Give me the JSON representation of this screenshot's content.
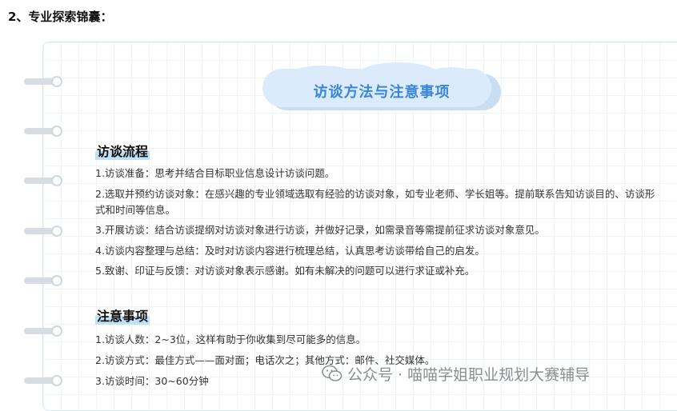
{
  "heading": "2、专业探索锦囊：",
  "card_title": "访谈方法与注意事项",
  "section1": {
    "title": "访谈流程",
    "items": [
      "1.访谈准备：思考并结合目标职业信息设计访谈问题。",
      "2.选取并预约访谈对象：在感兴趣的专业领域选取有经验的访谈对象，如专业老师、学长姐等。提前联系告知访谈目的、访谈形",
      "式和时间等信息。",
      "3.开展访谈：结合访谈提纲对访谈对象进行访谈，并做好记录，如需录音等需提前征求访谈对象意见。",
      "4.访谈内容整理与总结：及时对访谈内容进行梳理总结，认真思考访谈带给自己的启发。",
      "5.致谢、印证与反馈：对访谈对象表示感谢。如有未解决的问题可以进行求证或补充。"
    ]
  },
  "section2": {
    "title": "注意事项",
    "items": [
      "1.访谈人数：2~3位，这样有助于你收集到尽可能多的信息。",
      "2.访谈方式：最佳方式——面对面；电话次之；其他方式：邮件、社交媒体。",
      "3.访谈时间：30~60分钟"
    ]
  },
  "watermark": "公众号 · 喵喵学姐职业规划大赛辅导",
  "icons": [
    "wechat-icon"
  ],
  "colors": {
    "accent": "#3a86d6",
    "cloud": "#dcebfb",
    "highlight": "#bfe0f5"
  }
}
